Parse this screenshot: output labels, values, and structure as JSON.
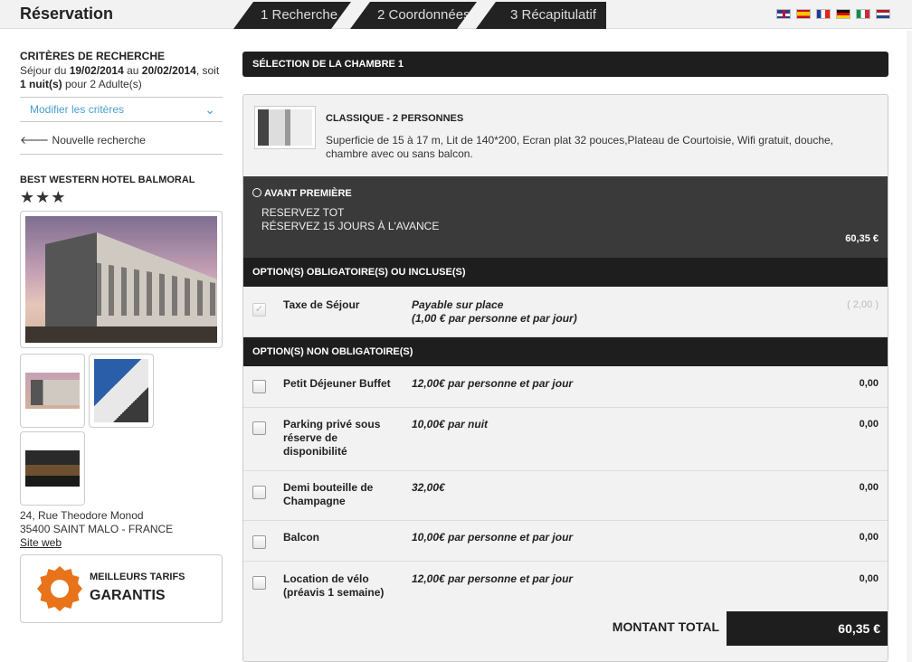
{
  "header": {
    "title": "Réservation",
    "steps": [
      "1 Recherche",
      "2 Coordonnées",
      "3 Récapitulatif"
    ],
    "flags": [
      "flag-en-icon",
      "flag-es-icon",
      "flag-fr-icon",
      "flag-de-icon",
      "flag-it-icon",
      "flag-nl-icon"
    ]
  },
  "sidebar": {
    "criteria_heading": "CRITÈRES DE RECHERCHE",
    "stay_prefix": "Séjour du ",
    "date_from": "19/02/2014",
    "stay_mid": " au ",
    "date_to": "20/02/2014",
    "stay_suffix": ", soit",
    "nights": "1 nuit(s)",
    "guests": " pour 2 Adulte(s)",
    "modify_label": "Modifier les critères",
    "new_search_label": "Nouvelle recherche",
    "hotel_name": "BEST WESTERN HOTEL BALMORAL",
    "stars": "★★★",
    "address_line1": "24, Rue Theodore Monod",
    "address_line2": "35400 SAINT MALO - FRANCE",
    "site_web": "Site web",
    "best_rates_l1": "MEILLEURS TARIFS",
    "best_rates_l2": "GARANTIS"
  },
  "main": {
    "selection_heading": "SÉLECTION DE LA CHAMBRE 1",
    "room_title": "CLASSIQUE - 2 PERSONNES",
    "room_desc": "Superficie de 15 à 17 m, Lit de 140*200, Ecran plat 32 pouces,Plateau de Courtoisie, Wifi gratuit, douche, chambre avec ou sans balcon.",
    "promo_title": "AVANT PREMIÈRE",
    "promo_line1": "RESERVEZ TOT",
    "promo_line2": "RÉSERVEZ 15 JOURS À L'AVANCE",
    "promo_price": "60,35  €",
    "mandatory_heading": "OPTION(S) OBLIGATOIRE(S) OU INCLUSE(S)",
    "mandatory": {
      "name": "Taxe de Séjour",
      "price_l1": "Payable sur place",
      "price_l2": "(1,00 € par personne et par jour)",
      "value": "( 2,00 )"
    },
    "optional_heading": "OPTION(S) NON OBLIGATOIRE(S)",
    "options": [
      {
        "name": "Petit Déjeuner Buffet",
        "price": "12,00€ par personne et par jour",
        "value": "0,00"
      },
      {
        "name": "Parking privé sous réserve de disponibilité",
        "price": "10,00€ par nuit",
        "value": "0,00"
      },
      {
        "name": "Demi bouteille de Champagne",
        "price": "32,00€",
        "value": "0,00"
      },
      {
        "name": "Balcon",
        "price": "10,00€ par personne et par jour",
        "value": "0,00"
      },
      {
        "name": "Location de vélo (préavis 1 semaine)",
        "price": "12,00€ par personne et par jour",
        "value": "0,00"
      }
    ],
    "total_label": "MONTANT TOTAL",
    "total_value": "60,35  €"
  }
}
